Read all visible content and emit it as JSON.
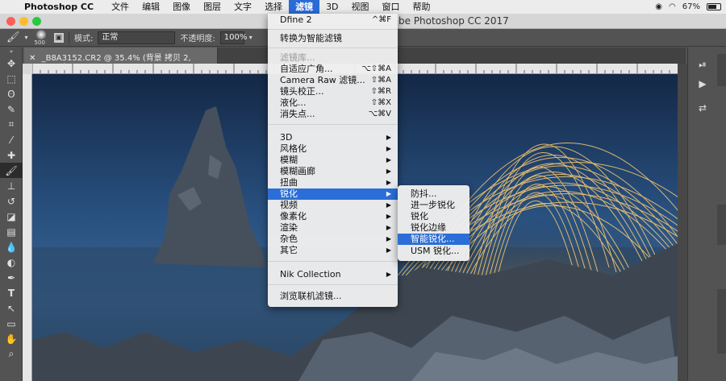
{
  "menubar": {
    "app_name": "Photoshop CC",
    "items": [
      "文件",
      "编辑",
      "图像",
      "图层",
      "文字",
      "选择",
      "滤镜",
      "3D",
      "视图",
      "窗口",
      "帮助"
    ],
    "active_item": "滤镜",
    "battery": "67%"
  },
  "window": {
    "title": "be Photoshop CC 2017"
  },
  "options": {
    "brush_size": "500",
    "mode_label": "模式:",
    "mode_value": "正常",
    "opacity_label": "不透明度:",
    "opacity_value": "100%"
  },
  "document": {
    "tab": "_B8A3152.CR2 @ 35.4% (背景 拷贝 2, RGB/16*) *"
  },
  "filter_menu": {
    "last_filter": {
      "label": "Dfine 2",
      "shortcut": "^⌘F"
    },
    "convert_smart": "转换为智能滤镜",
    "gallery": "滤镜库...",
    "adaptive_wide": {
      "label": "自适应广角...",
      "shortcut": "⌥⇧⌘A"
    },
    "camera_raw": {
      "label": "Camera Raw 滤镜...",
      "shortcut": "⇧⌘A"
    },
    "lens_correction": {
      "label": "镜头校正...",
      "shortcut": "⇧⌘R"
    },
    "liquify": {
      "label": "液化...",
      "shortcut": "⇧⌘X"
    },
    "vanishing_point": {
      "label": "消失点...",
      "shortcut": "⌥⌘V"
    },
    "submenus": [
      "3D",
      "风格化",
      "模糊",
      "模糊画廊",
      "扭曲",
      "锐化",
      "视频",
      "像素化",
      "渲染",
      "杂色",
      "其它"
    ],
    "highlighted": "锐化",
    "nik": "Nik Collection",
    "browse_online": "浏览联机滤镜..."
  },
  "sharpen_menu": {
    "items": [
      "防抖...",
      "进一步锐化",
      "锐化",
      "锐化边缘",
      "智能锐化...",
      "USM 锐化..."
    ],
    "highlighted": "智能锐化..."
  },
  "colors": {
    "menu_highlight": "#2b6ed7",
    "panel_bg": "#535353"
  }
}
